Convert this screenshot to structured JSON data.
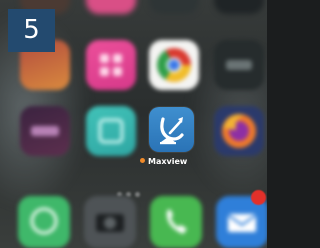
{
  "step_number": "5",
  "highlighted_app": {
    "name": "Maxview",
    "icon": "maxview-satellite-icon",
    "icon_color": "#2f7fc1",
    "dot_color": "#ef8a2a"
  },
  "home_screen": {
    "blurred_icons": [
      "pink-app-icon",
      "chrome-icon",
      "dark-app-icon",
      "dark-purple-app-icon",
      "teal-app-icon",
      "firefox-icon"
    ],
    "dock_icons": [
      "whatsapp-icon",
      "camera-icon",
      "phone-icon",
      "mail-icon"
    ],
    "notification_badge_color": "#e3302a"
  }
}
